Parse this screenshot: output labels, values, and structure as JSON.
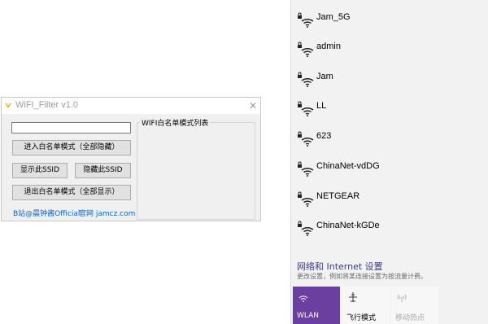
{
  "app": {
    "title": "WiFI_Filter v1.0",
    "close_glyph": "✕",
    "input_value": "",
    "btn_enter_whitelist": "进入白名单模式（全部隐藏）",
    "btn_show_ssid": "显示此SSID",
    "btn_hide_ssid": "隐藏此SSID",
    "btn_exit_whitelist": "退出白名单模式（全部显示）",
    "whitelist_group_title": "WIFI白名单模式列表",
    "link_bilibili": "B站@晨钟酱Official",
    "link_site": "官网 jamcz.com",
    "icon": "app-logo-icon"
  },
  "flyout": {
    "networks": [
      {
        "name": "Jam_5G",
        "icon": "wifi-secured-icon"
      },
      {
        "name": "admin",
        "icon": "wifi-secured-icon"
      },
      {
        "name": "Jam",
        "icon": "wifi-secured-icon"
      },
      {
        "name": "LL",
        "icon": "wifi-secured-icon"
      },
      {
        "name": "623",
        "icon": "wifi-secured-icon"
      },
      {
        "name": "ChinaNet-vdDG",
        "icon": "wifi-secured-icon"
      },
      {
        "name": "NETGEAR",
        "icon": "wifi-secured-icon"
      },
      {
        "name": "ChinaNet-kGDe",
        "icon": "wifi-secured-icon"
      }
    ],
    "settings_link": "网络和 Internet 设置",
    "settings_desc": "更改设置，例如将某连接设置为按流量计费。",
    "quick_actions": [
      {
        "label": "WLAN",
        "icon": "wifi-icon",
        "active": true
      },
      {
        "label": "飞行模式",
        "icon": "airplane-icon",
        "active": false
      },
      {
        "label": "移动热点",
        "icon": "hotspot-icon",
        "active": false
      }
    ]
  },
  "colors": {
    "accent": "#6b3fa0",
    "link": "#0066cc",
    "flyout_bg": "#f2f2f2",
    "window_bg": "#f0f0f0"
  }
}
